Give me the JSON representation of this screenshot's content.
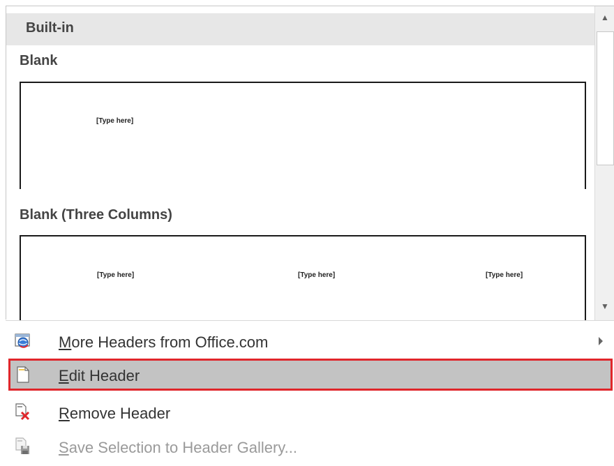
{
  "gallery": {
    "section_label": "Built-in",
    "items": [
      {
        "title": "Blank",
        "placeholders": [
          "[Type here]"
        ]
      },
      {
        "title": "Blank (Three Columns)",
        "placeholders": [
          "[Type here]",
          "[Type here]",
          "[Type here]"
        ]
      }
    ]
  },
  "scrollbar": {
    "up_icon": "scroll-up-arrow",
    "down_icon": "scroll-down-arrow"
  },
  "menu": {
    "items": [
      {
        "mnemonic": "M",
        "rest": "ore Headers from Office.com",
        "icon": "office-web-icon",
        "has_submenu": true,
        "state": "normal"
      },
      {
        "mnemonic": "E",
        "rest": "dit Header",
        "icon": "page-icon",
        "has_submenu": false,
        "state": "selected"
      },
      {
        "mnemonic": "R",
        "rest": "emove Header",
        "icon": "remove-page-icon",
        "has_submenu": false,
        "state": "normal"
      },
      {
        "mnemonic": "S",
        "rest": "ave Selection to Header Gallery...",
        "icon": "save-to-gallery-icon",
        "has_submenu": false,
        "state": "disabled"
      }
    ]
  },
  "colors": {
    "highlight_border": "#e0262b",
    "selected_bg": "#c3c3c3",
    "section_bg": "#e7e7e7"
  }
}
